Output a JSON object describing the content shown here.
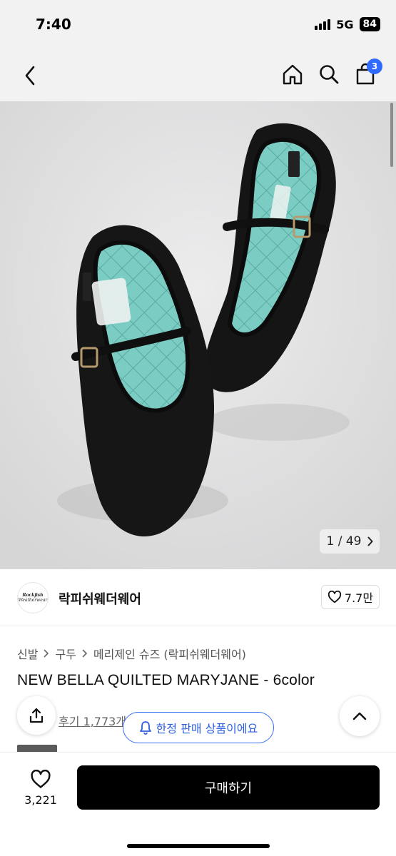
{
  "status_bar": {
    "time": "7:40",
    "network": "5G",
    "battery": "84"
  },
  "nav": {
    "cart_count": "3"
  },
  "gallery": {
    "current": "1",
    "separator": "/",
    "total": "49"
  },
  "brand": {
    "name": "락피쉬웨더웨어",
    "logo_line1": "Rockfish",
    "logo_line2": "Weatherwear",
    "likes": "7.7만"
  },
  "breadcrumb": [
    "신발",
    "구두",
    "메리제인 슈즈 (락피쉬웨더웨어)"
  ],
  "product": {
    "title": "NEW BELLA QUILTED MARYJANE - 6color"
  },
  "review": {
    "label": "후기 1,773개"
  },
  "toast": {
    "label": "한정 판매 상품이에요"
  },
  "bottom": {
    "wish_count": "3,221",
    "buy_label": "구매하기"
  },
  "colors": {
    "accent": "#2f6bff",
    "buy_button": "#000000",
    "shoe_lining": "#7ccfc7",
    "shoe_body": "#141414"
  },
  "icons": [
    "back-icon",
    "home-icon",
    "search-icon",
    "cart-icon",
    "chevron-right-icon",
    "heart-icon",
    "share-icon",
    "bell-icon",
    "chevron-up-icon"
  ]
}
